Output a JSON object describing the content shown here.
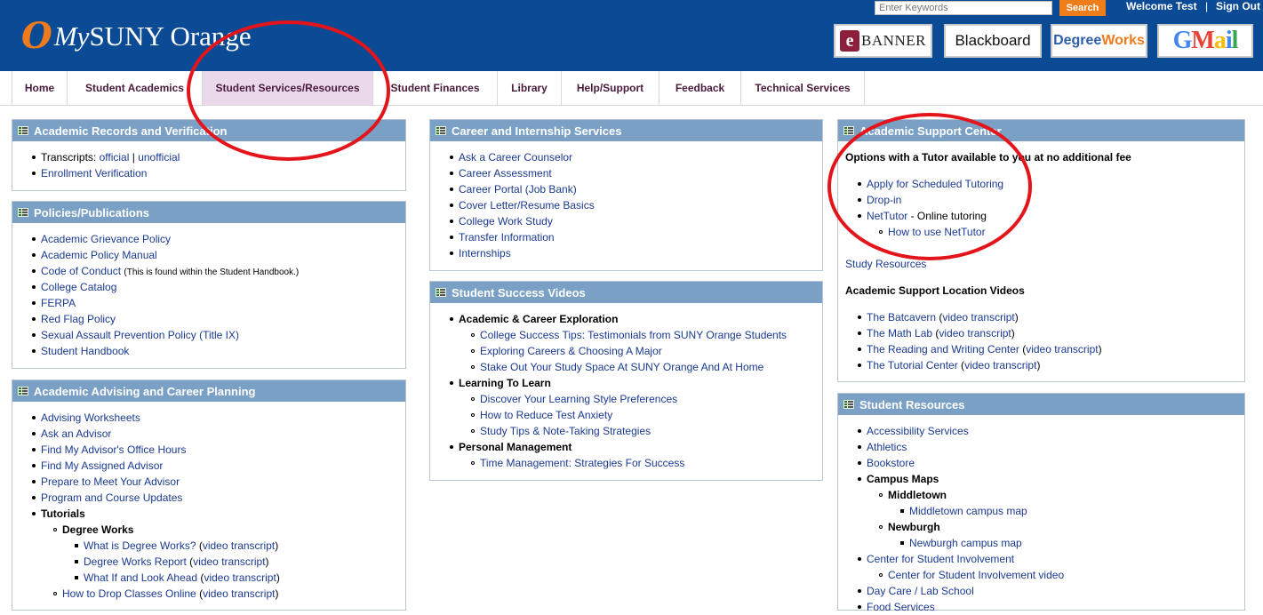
{
  "header": {
    "logo_mark": "O",
    "logo_my": "My",
    "logo_name": "SUNY Orange",
    "search_placeholder": "Enter Keywords",
    "search_button": "Search",
    "welcome": "Welcome Test",
    "separator": "|",
    "sign_out": "Sign Out",
    "quick_links": {
      "banner_e": "e",
      "banner": "BANNER",
      "blackboard": "Blackboard",
      "degreeworks_a": "Degree",
      "degreeworks_b": "Works",
      "gmail": "GMail"
    }
  },
  "nav": {
    "tabs": [
      "Home",
      "Student Academics",
      "Student Services/Resources",
      "Student Finances",
      "Library",
      "Help/Support",
      "Feedback",
      "Technical Services"
    ],
    "active": "Student Services/Resources"
  },
  "panels": {
    "academic_records": {
      "title": "Academic Records and Verification",
      "transcripts_label": "Transcripts:",
      "official": "official",
      "bar": "|",
      "unofficial": "unofficial",
      "enrollment": "Enrollment Verification"
    },
    "policies": {
      "title": "Policies/Publications",
      "items": [
        "Academic Grievance Policy",
        "Academic Policy Manual",
        "Code of Conduct",
        "College Catalog",
        "FERPA",
        "Red Flag Policy",
        "Sexual Assault Prevention Policy (Title IX)",
        "Student Handbook"
      ],
      "conduct_note": "(This is found within the Student Handbook.)"
    },
    "advising": {
      "title": "Academic Advising and Career Planning",
      "items": [
        "Advising Worksheets",
        "Ask an Advisor",
        "Find My Advisor's Office Hours",
        "Find My Assigned Advisor",
        "Prepare to Meet Your Advisor",
        "Program and Course Updates"
      ],
      "tutorials": "Tutorials",
      "degree_works": "Degree Works",
      "dw_items": [
        "What is Degree Works?",
        "Degree Works Report",
        "What If and Look Ahead"
      ],
      "video_transcript": "video transcript",
      "drop_classes": "How to Drop Classes Online"
    },
    "career": {
      "title": "Career and Internship Services",
      "items": [
        "Ask a Career Counselor",
        "Career Assessment",
        "Career Portal (Job Bank)",
        "Cover Letter/Resume Basics",
        "College Work Study",
        "Transfer Information",
        "Internships"
      ]
    },
    "videos": {
      "title": "Student Success Videos",
      "groups": [
        {
          "label": "Academic & Career Exploration",
          "items": [
            "College Success Tips: Testimonials from SUNY Orange Students",
            "Exploring Careers & Choosing A Major",
            "Stake Out Your Study Space At SUNY Orange And At Home"
          ]
        },
        {
          "label": "Learning To Learn",
          "items": [
            "Discover Your Learning Style Preferences",
            "How to Reduce Test Anxiety",
            "Study Tips & Note-Taking Strategies"
          ]
        },
        {
          "label": "Personal Management",
          "items": [
            "Time Management: Strategies For Success"
          ]
        }
      ]
    },
    "support": {
      "title": "Academic Support Center",
      "intro": "Options with a Tutor available to you at no additional fee",
      "apply": "Apply for Scheduled Tutoring",
      "dropin": "Drop-in",
      "nettutor": "NetTutor",
      "nettutor_desc": " - Online tutoring",
      "how_nettutor": "How to use NetTutor",
      "study": "Study Resources",
      "location_title": "Academic Support Location Videos",
      "locations": [
        "The Batcavern",
        "The Math Lab",
        "The Reading and Writing Center",
        "The Tutorial Center"
      ],
      "video_transcript": "video transcript"
    },
    "resources": {
      "title": "Student Resources",
      "items": [
        "Accessibility Services",
        "Athletics",
        "Bookstore"
      ],
      "campus_maps": "Campus Maps",
      "middletown": "Middletown",
      "middletown_map": "Middletown campus map",
      "newburgh": "Newburgh",
      "newburgh_map": "Newburgh campus map",
      "involvement": "Center for Student Involvement",
      "involvement_video": "Center for Student Involvement video",
      "daycare": "Day Care / Lab School",
      "food": "Food Services"
    }
  },
  "colors": {
    "header": "#0b4a94",
    "panel_header": "#7aa1c5",
    "link": "#1a3a8f",
    "search": "#ef7d1a",
    "annotation": "#e3141a"
  }
}
